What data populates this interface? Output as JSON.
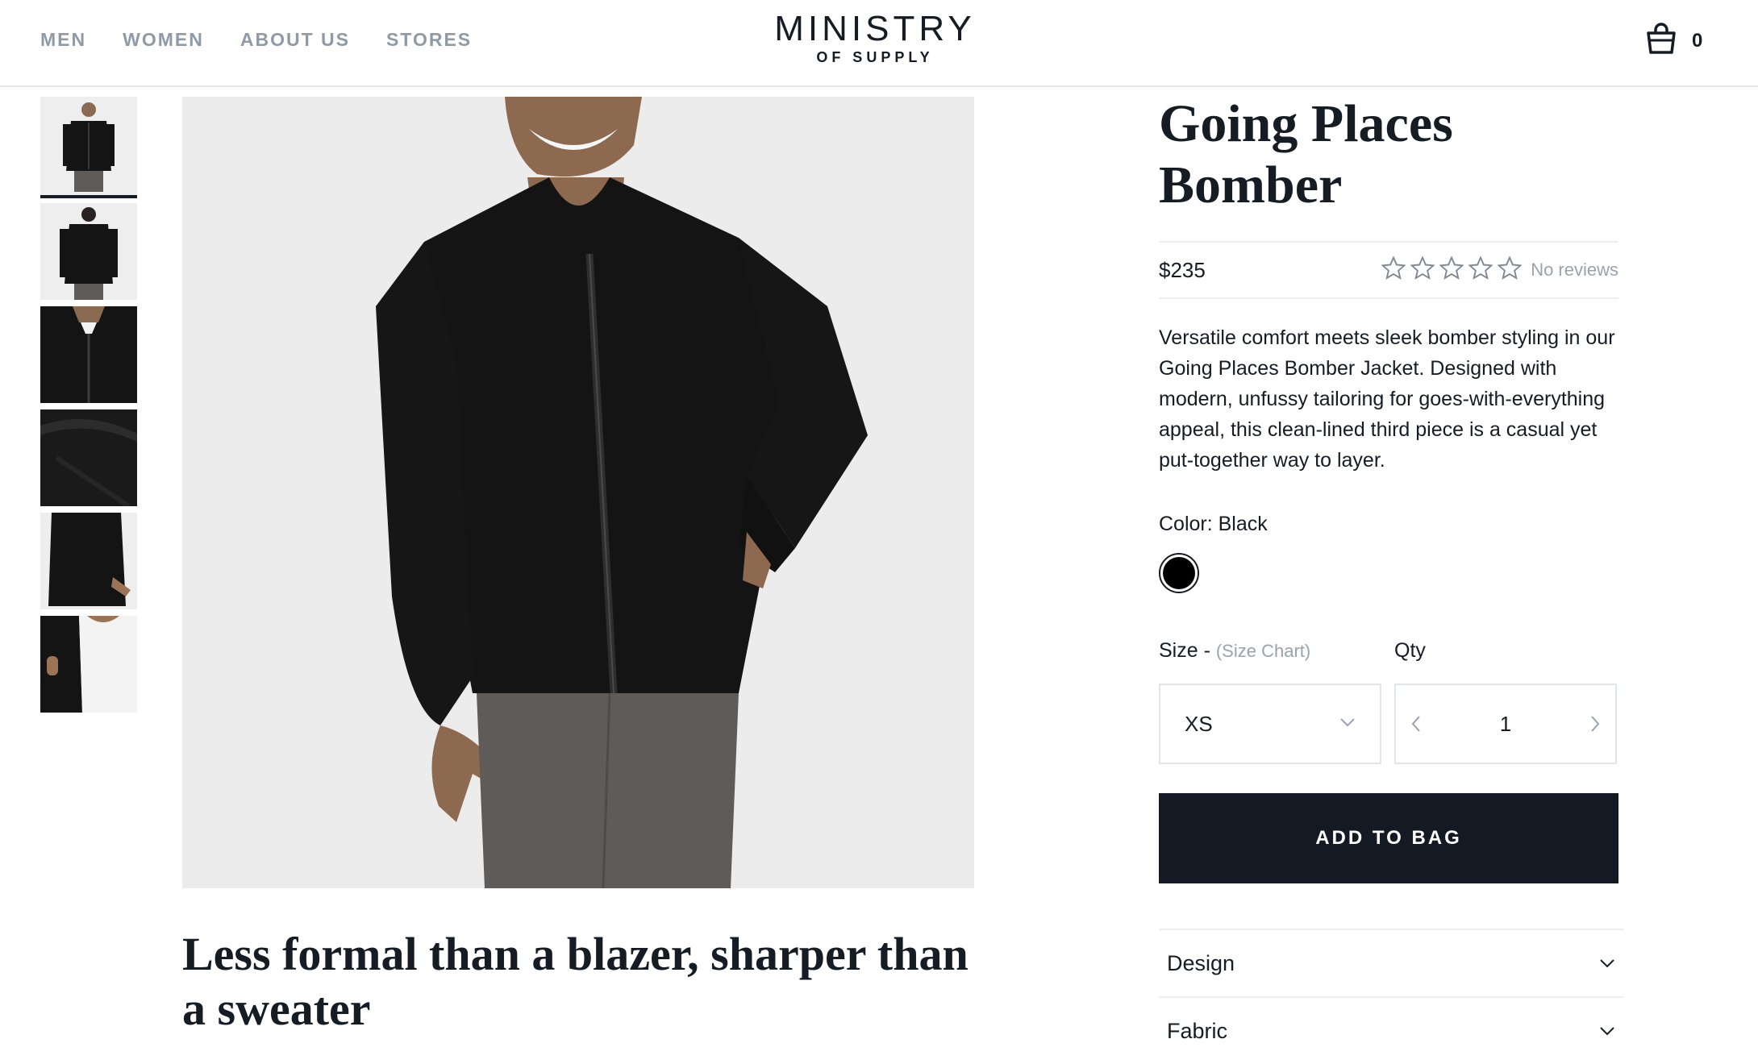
{
  "header": {
    "nav": [
      "MEN",
      "WOMEN",
      "ABOUT US",
      "STORES"
    ],
    "logo_main": "MINISTRY",
    "logo_sub": "OF SUPPLY",
    "cart_icon": "shopping-bag-icon",
    "cart_count": "0"
  },
  "gallery": {
    "thumbnails": [
      "front-view",
      "back-view",
      "collar-detail",
      "fabric-detail",
      "side-detail",
      "lining-detail"
    ],
    "selected_index": 0
  },
  "product": {
    "title_line1": "Going Places",
    "title_line2": "Bomber",
    "price": "$235",
    "rating": 0,
    "rating_max": 5,
    "reviews": "No reviews",
    "description": "Versatile comfort meets sleek bomber styling in our Going Places Bomber Jacket. Designed with modern, unfussy tailoring for goes-with-everything appeal, this clean-lined third piece is a casual yet put-together way to layer.",
    "color_label": "Color: Black",
    "color_hex": "#000000",
    "size_label": "Size -",
    "size_chart_link": "(Size Chart)",
    "size_value": "XS",
    "qty_label": "Qty",
    "qty_value": "1",
    "add_to_bag": "ADD TO BAG",
    "accordions": [
      "Design",
      "Fabric"
    ]
  },
  "headline": "Less formal than a blazer, sharper than a sweater"
}
